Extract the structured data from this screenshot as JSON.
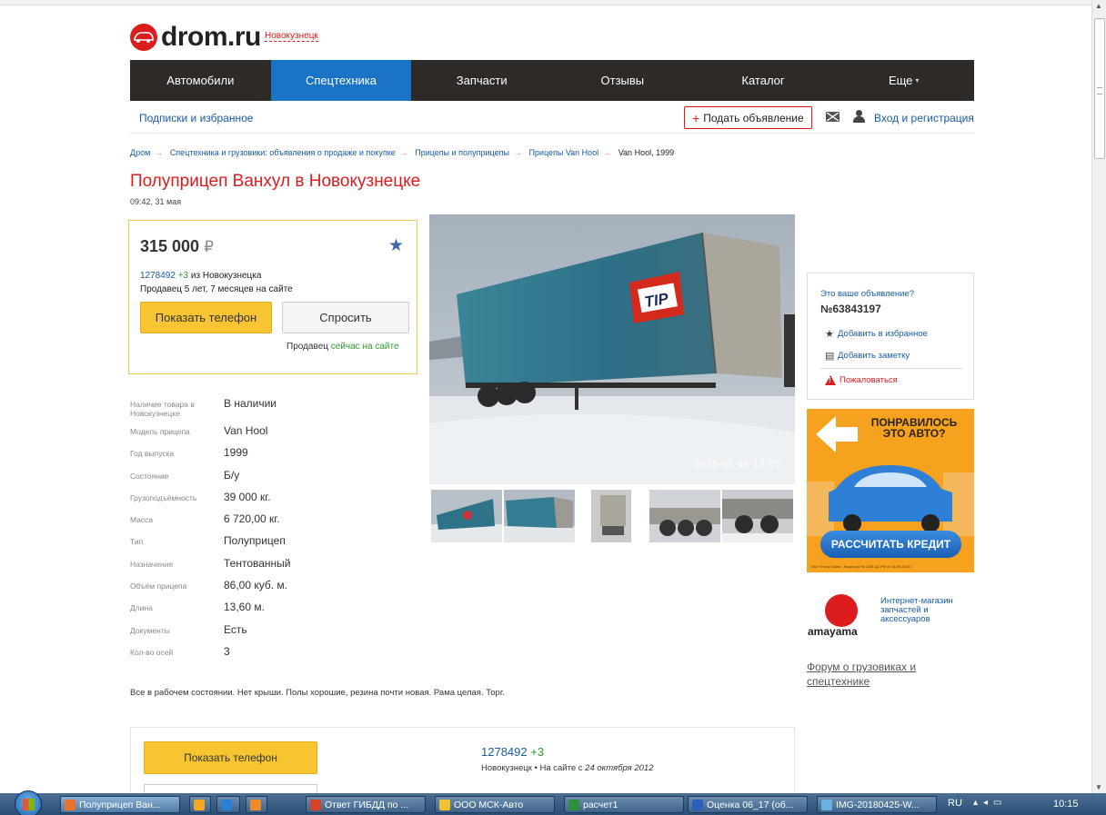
{
  "header": {
    "logo_text": "drom.ru",
    "city": "Новокузнецк"
  },
  "nav": [
    {
      "label": "Автомобили",
      "active": false
    },
    {
      "label": "Спецтехника",
      "active": true
    },
    {
      "label": "Запчасти",
      "active": false
    },
    {
      "label": "Отзывы",
      "active": false
    },
    {
      "label": "Каталог",
      "active": false
    },
    {
      "label": "Еще",
      "active": false
    }
  ],
  "subnav": {
    "subscriptions": "Подписки и избранное",
    "add_ad": "Подать объявление",
    "login": "Вход и регистрация"
  },
  "breadcrumb": {
    "items": [
      "Дром",
      "Спецтехника и грузовики: объявления о продаже и покупке",
      "Прицепы и полуприцепы",
      "Прицепы Van Hool"
    ],
    "current": "Van Hool, 1999"
  },
  "listing": {
    "title": "Полуприцеп Ванхул в Новокузнецке",
    "date": "09:42, 31 мая",
    "price": "315 000",
    "currency": "₽",
    "seller_id": "1278492",
    "seller_plus": "+3",
    "seller_city": " из Новокузнецка",
    "seller_age": "Продавец 5 лет, 7 месяцев на сайте",
    "show_phone": "Показать телефон",
    "ask": "Спросить",
    "online_prefix": "Продавец ",
    "online_status": "сейчас на сайте",
    "specs": [
      {
        "label": "Наличие товара в Новокузнецке",
        "value": "В наличии"
      },
      {
        "label": "Модель прицепа",
        "value": "Van Hool"
      },
      {
        "label": "Год выпуска",
        "value": "1999"
      },
      {
        "label": "Состояние",
        "value": "Б/у"
      },
      {
        "label": "Грузоподъёмность",
        "value": "39 000 кг."
      },
      {
        "label": "Масса",
        "value": "6 720,00 кг."
      },
      {
        "label": "Тип",
        "value": "Полуприцеп"
      },
      {
        "label": "Назначение",
        "value": "Тентованный"
      },
      {
        "label": "Объём прицепа",
        "value": "86,00 куб. м."
      },
      {
        "label": "Длина",
        "value": "13,60 м."
      },
      {
        "label": "Документы",
        "value": "Есть"
      },
      {
        "label": "Кол-во осей",
        "value": "3"
      }
    ],
    "description": "Все в рабочем состоянии. Нет крыши. Полы хорошие, резина почти новая. Рама целая. Торг.",
    "photo_timestamp": "2018-01-16 13:05",
    "trailer_logo": "TIP"
  },
  "sidebar": {
    "owner_question": "Это ваше объявление?",
    "ad_number": "№63843197",
    "add_favorite": "Добавить в избранное",
    "add_note": "Добавить заметку",
    "report": "Пожаловаться",
    "banner_headline": "ПОНРАВИЛОСЬ ЭТО АВТО?",
    "banner_button": "РАССЧИТАТЬ КРЕДИТ",
    "banner_fine": "ПАО «Плюс Банк». Лицензия № 1189 ЦБ РФ от 16.09.2015 г.",
    "amayama_name": "amayama",
    "amayama_text": "Интернет-магазин запчастей и аксессуаров",
    "forum": "Форум о грузовиках и спецтехнике"
  },
  "bottom": {
    "show_phone": "Показать телефон",
    "seller_id": "1278492",
    "seller_plus": "+3",
    "city": "Новокузнецк",
    "since_prefix": "На сайте с ",
    "since_date": "24 октября 2012"
  },
  "taskbar": {
    "tasks": [
      {
        "label": "Полуприцеп Ван...",
        "color": "#e8742a",
        "active": true
      },
      {
        "label": "",
        "color": "#f5a623",
        "active": false
      },
      {
        "label": "",
        "color": "#2d7fd6",
        "active": false
      },
      {
        "label": "",
        "color": "#f08a24",
        "active": false
      },
      {
        "label": "Ответ ГИБДД по ...",
        "color": "#d9412b",
        "active": false
      },
      {
        "label": "ООО МСК-Авто",
        "color": "#f2c12e",
        "active": false
      },
      {
        "label": "расчет1",
        "color": "#2f8f3c",
        "active": false
      },
      {
        "label": "Оценка 06_17 (об...",
        "color": "#2b5fb8",
        "active": false
      },
      {
        "label": "IMG-20180425-W...",
        "color": "#6ab0e0",
        "active": false
      }
    ],
    "lang": "RU",
    "time": "10:15"
  }
}
